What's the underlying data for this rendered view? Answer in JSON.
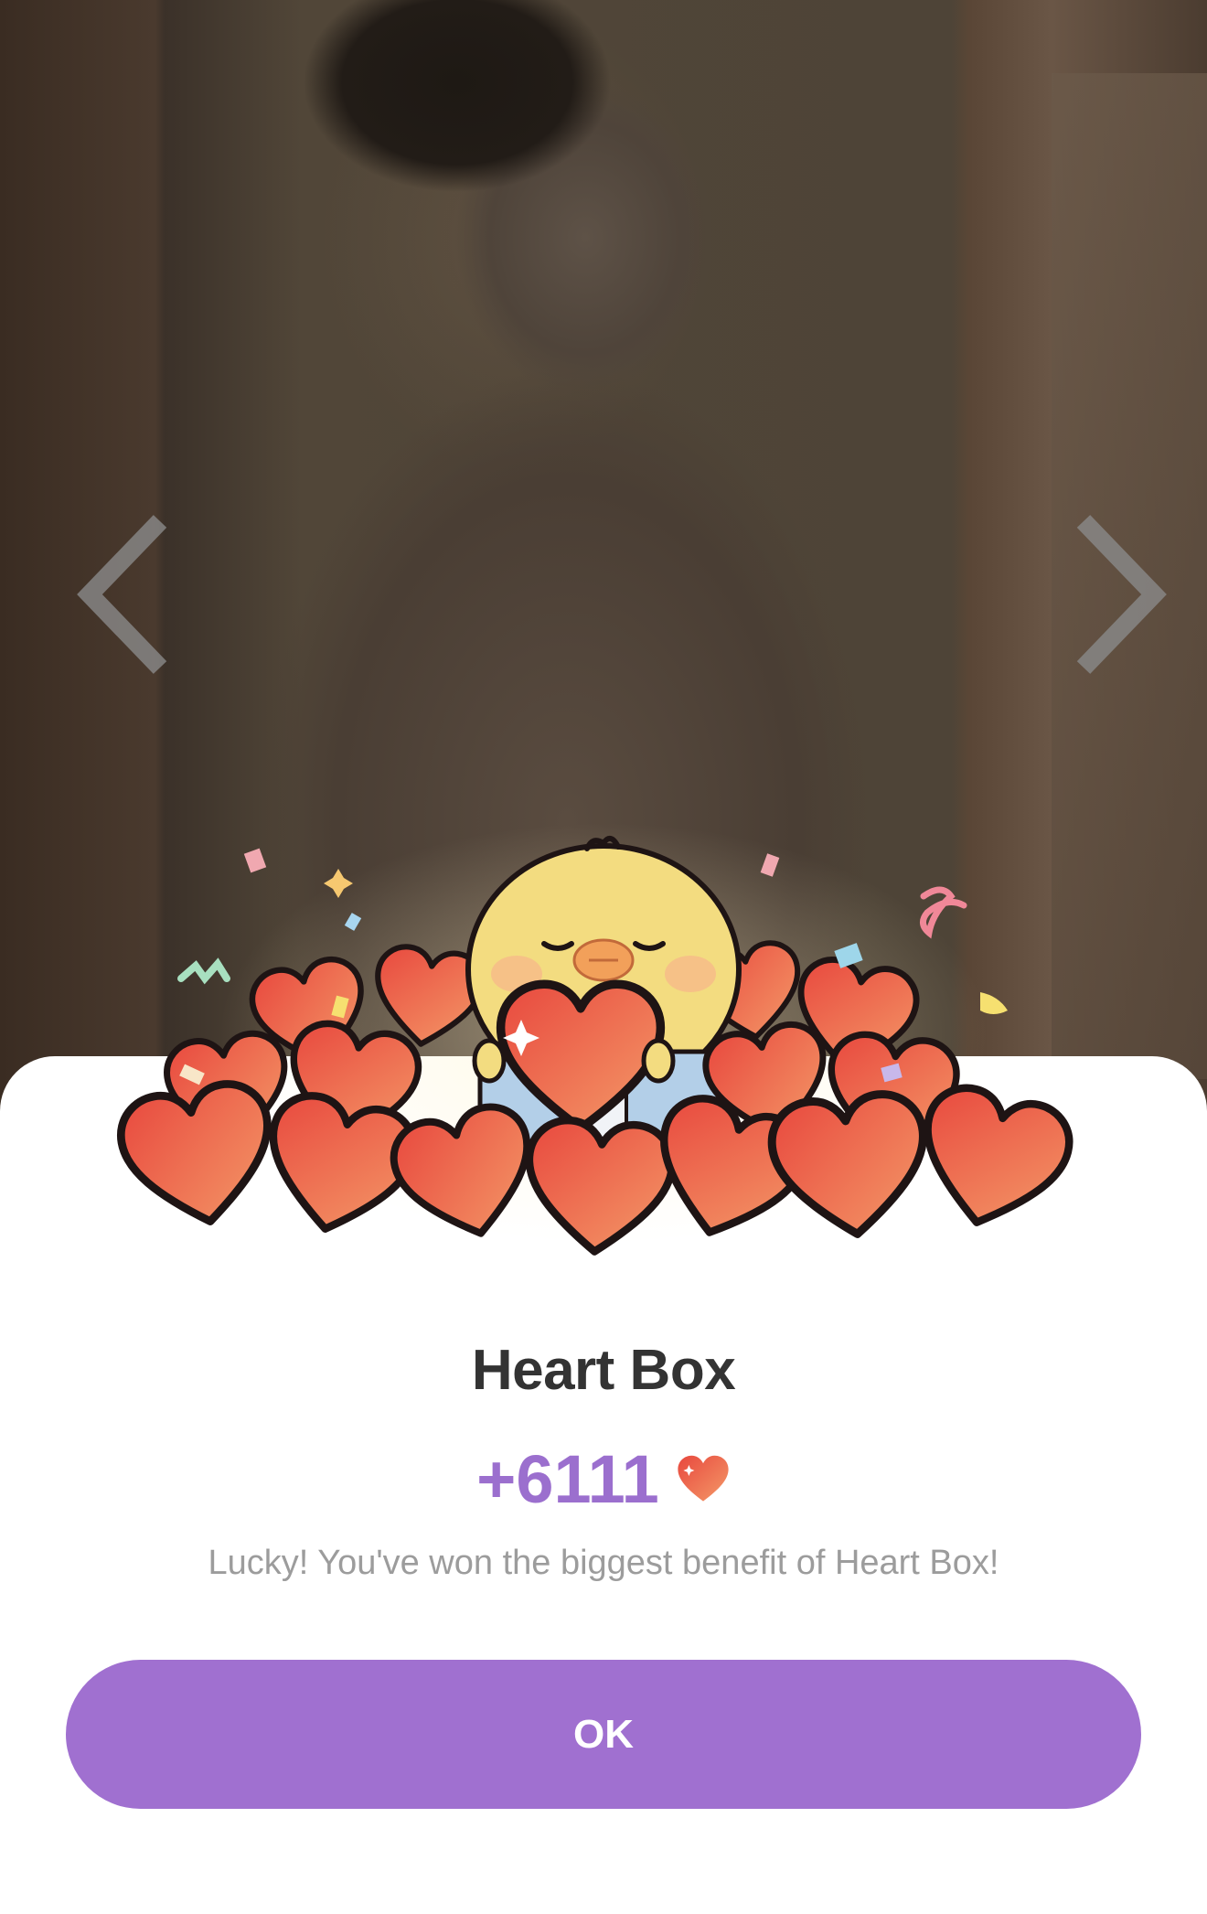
{
  "background": {
    "description_icon": "photo-backdrop",
    "prev_icon": "chevron-left-icon",
    "next_icon": "chevron-right-icon"
  },
  "dialog": {
    "illustration_icon": "chick-hugging-heart-icon",
    "title": "Heart Box",
    "reward_amount": "+6111",
    "reward_icon": "heart-icon",
    "message": "Lucky! You've won the biggest benefit of Heart Box!",
    "ok_label": "OK"
  },
  "colors": {
    "accent": "#a070d0",
    "reward_text": "#9b6fce",
    "title_text": "#333333",
    "message_text": "#9c9c9c",
    "heart_fill": "#f06a50"
  }
}
